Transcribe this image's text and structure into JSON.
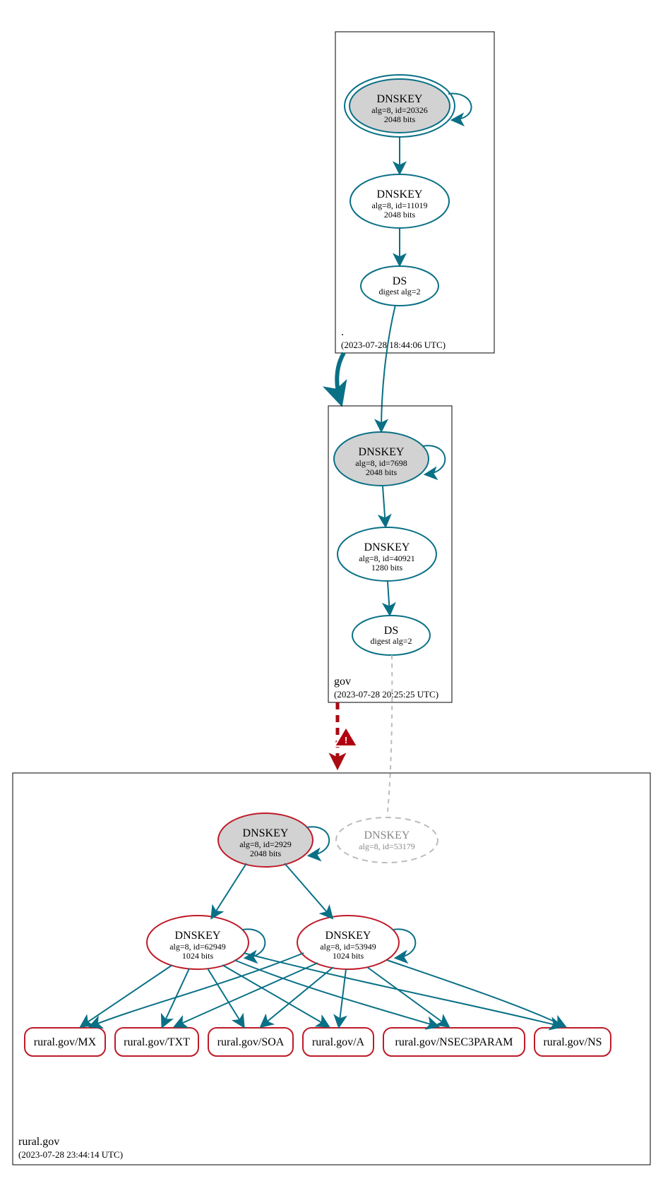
{
  "zones": {
    "root": {
      "label": ".",
      "timestamp": "(2023-07-28 18:44:06 UTC)"
    },
    "gov": {
      "label": "gov",
      "timestamp": "(2023-07-28 20:25:25 UTC)"
    },
    "rural": {
      "label": "rural.gov",
      "timestamp": "(2023-07-28 23:44:14 UTC)"
    }
  },
  "nodes": {
    "root_ksk": {
      "title": "DNSKEY",
      "line1": "alg=8, id=20326",
      "line2": "2048 bits"
    },
    "root_zsk": {
      "title": "DNSKEY",
      "line1": "alg=8, id=11019",
      "line2": "2048 bits"
    },
    "root_ds": {
      "title": "DS",
      "line1": "digest alg=2"
    },
    "gov_ksk": {
      "title": "DNSKEY",
      "line1": "alg=8, id=7698",
      "line2": "2048 bits"
    },
    "gov_zsk": {
      "title": "DNSKEY",
      "line1": "alg=8, id=40921",
      "line2": "1280 bits"
    },
    "gov_ds": {
      "title": "DS",
      "line1": "digest alg=2"
    },
    "rural_ksk": {
      "title": "DNSKEY",
      "line1": "alg=8, id=2929",
      "line2": "2048 bits"
    },
    "rural_miss": {
      "title": "DNSKEY",
      "line1": "alg=8, id=53179"
    },
    "rural_zsk1": {
      "title": "DNSKEY",
      "line1": "alg=8, id=62949",
      "line2": "1024 bits"
    },
    "rural_zsk2": {
      "title": "DNSKEY",
      "line1": "alg=8, id=53949",
      "line2": "1024 bits"
    }
  },
  "rrsets": {
    "mx": "rural.gov/MX",
    "txt": "rural.gov/TXT",
    "soa": "rural.gov/SOA",
    "a": "rural.gov/A",
    "nsec": "rural.gov/NSEC3PARAM",
    "ns": "rural.gov/NS"
  },
  "warning_icon": "!",
  "chart_data": {
    "type": "graph",
    "description": "DNSSEC delegation / signing graph (DNSViz-style) for rural.gov",
    "zones": [
      {
        "name": ".",
        "queried_at": "2023-07-28 18:44:06 UTC"
      },
      {
        "name": "gov",
        "queried_at": "2023-07-28 20:25:25 UTC"
      },
      {
        "name": "rural.gov",
        "queried_at": "2023-07-28 23:44:14 UTC"
      }
    ],
    "nodes": [
      {
        "id": "root_ksk",
        "zone": ".",
        "type": "DNSKEY",
        "alg": 8,
        "key_id": 20326,
        "bits": 2048,
        "role": "KSK/trust-anchor",
        "style": "double-ellipse-filled-teal"
      },
      {
        "id": "root_zsk",
        "zone": ".",
        "type": "DNSKEY",
        "alg": 8,
        "key_id": 11019,
        "bits": 2048,
        "role": "ZSK",
        "style": "ellipse-teal"
      },
      {
        "id": "root_ds",
        "zone": ".",
        "type": "DS",
        "digest_alg": 2,
        "style": "ellipse-teal"
      },
      {
        "id": "gov_ksk",
        "zone": "gov",
        "type": "DNSKEY",
        "alg": 8,
        "key_id": 7698,
        "bits": 2048,
        "role": "KSK",
        "style": "ellipse-filled-teal"
      },
      {
        "id": "gov_zsk",
        "zone": "gov",
        "type": "DNSKEY",
        "alg": 8,
        "key_id": 40921,
        "bits": 1280,
        "role": "ZSK",
        "style": "ellipse-teal"
      },
      {
        "id": "gov_ds",
        "zone": "gov",
        "type": "DS",
        "digest_alg": 2,
        "style": "ellipse-teal"
      },
      {
        "id": "rural_ksk",
        "zone": "rural.gov",
        "type": "DNSKEY",
        "alg": 8,
        "key_id": 2929,
        "bits": 2048,
        "role": "KSK",
        "style": "ellipse-filled-red"
      },
      {
        "id": "rural_miss",
        "zone": "rural.gov",
        "type": "DNSKEY",
        "alg": 8,
        "key_id": 53179,
        "role": "missing",
        "style": "ellipse-dashed-grey"
      },
      {
        "id": "rural_zsk1",
        "zone": "rural.gov",
        "type": "DNSKEY",
        "alg": 8,
        "key_id": 62949,
        "bits": 1024,
        "role": "ZSK",
        "style": "ellipse-red"
      },
      {
        "id": "rural_zsk2",
        "zone": "rural.gov",
        "type": "DNSKEY",
        "alg": 8,
        "key_id": 53949,
        "bits": 1024,
        "role": "ZSK",
        "style": "ellipse-red"
      },
      {
        "id": "rr_mx",
        "zone": "rural.gov",
        "type": "RRset",
        "name": "rural.gov/MX",
        "style": "rrect-red"
      },
      {
        "id": "rr_txt",
        "zone": "rural.gov",
        "type": "RRset",
        "name": "rural.gov/TXT",
        "style": "rrect-red"
      },
      {
        "id": "rr_soa",
        "zone": "rural.gov",
        "type": "RRset",
        "name": "rural.gov/SOA",
        "style": "rrect-red"
      },
      {
        "id": "rr_a",
        "zone": "rural.gov",
        "type": "RRset",
        "name": "rural.gov/A",
        "style": "rrect-red"
      },
      {
        "id": "rr_nsec",
        "zone": "rural.gov",
        "type": "RRset",
        "name": "rural.gov/NSEC3PARAM",
        "style": "rrect-red"
      },
      {
        "id": "rr_ns",
        "zone": "rural.gov",
        "type": "RRset",
        "name": "rural.gov/NS",
        "style": "rrect-red"
      }
    ],
    "edges": [
      {
        "from": "root_ksk",
        "to": "root_ksk",
        "kind": "self-sign",
        "style": "teal-solid"
      },
      {
        "from": "root_ksk",
        "to": "root_zsk",
        "kind": "signs",
        "style": "teal-solid"
      },
      {
        "from": "root_zsk",
        "to": "root_ds",
        "kind": "signs",
        "style": "teal-solid"
      },
      {
        "from": "root_ds",
        "to": "gov_ksk",
        "kind": "delegation",
        "style": "teal-solid"
      },
      {
        "from": ".",
        "to": "gov",
        "kind": "zone-deleg",
        "style": "teal-solid-thick"
      },
      {
        "from": "gov_ksk",
        "to": "gov_ksk",
        "kind": "self-sign",
        "style": "teal-solid"
      },
      {
        "from": "gov_ksk",
        "to": "gov_zsk",
        "kind": "signs",
        "style": "teal-solid"
      },
      {
        "from": "gov_zsk",
        "to": "gov_ds",
        "kind": "signs",
        "style": "teal-solid"
      },
      {
        "from": "gov_ds",
        "to": "rural_miss",
        "kind": "ds-to-key",
        "style": "grey-dashed"
      },
      {
        "from": "gov",
        "to": "rural.gov",
        "kind": "zone-deleg",
        "style": "red-dashed-thick",
        "status": "warning"
      },
      {
        "from": "rural_ksk",
        "to": "rural_ksk",
        "kind": "self-sign",
        "style": "teal-solid"
      },
      {
        "from": "rural_ksk",
        "to": "rural_zsk1",
        "kind": "signs",
        "style": "teal-solid"
      },
      {
        "from": "rural_ksk",
        "to": "rural_zsk2",
        "kind": "signs",
        "style": "teal-solid"
      },
      {
        "from": "rural_zsk1",
        "to": "rural_zsk1",
        "kind": "self-sign",
        "style": "teal-solid"
      },
      {
        "from": "rural_zsk2",
        "to": "rural_zsk2",
        "kind": "self-sign",
        "style": "teal-solid"
      },
      {
        "from": "rural_zsk1",
        "to": "rr_mx",
        "kind": "signs",
        "style": "teal-solid"
      },
      {
        "from": "rural_zsk1",
        "to": "rr_txt",
        "kind": "signs",
        "style": "teal-solid"
      },
      {
        "from": "rural_zsk1",
        "to": "rr_soa",
        "kind": "signs",
        "style": "teal-solid"
      },
      {
        "from": "rural_zsk1",
        "to": "rr_a",
        "kind": "signs",
        "style": "teal-solid"
      },
      {
        "from": "rural_zsk1",
        "to": "rr_nsec",
        "kind": "signs",
        "style": "teal-solid"
      },
      {
        "from": "rural_zsk1",
        "to": "rr_ns",
        "kind": "signs",
        "style": "teal-solid"
      },
      {
        "from": "rural_zsk2",
        "to": "rr_mx",
        "kind": "signs",
        "style": "teal-solid"
      },
      {
        "from": "rural_zsk2",
        "to": "rr_txt",
        "kind": "signs",
        "style": "teal-solid"
      },
      {
        "from": "rural_zsk2",
        "to": "rr_soa",
        "kind": "signs",
        "style": "teal-solid"
      },
      {
        "from": "rural_zsk2",
        "to": "rr_a",
        "kind": "signs",
        "style": "teal-solid"
      },
      {
        "from": "rural_zsk2",
        "to": "rr_nsec",
        "kind": "signs",
        "style": "teal-solid"
      },
      {
        "from": "rural_zsk2",
        "to": "rr_ns",
        "kind": "signs",
        "style": "teal-solid"
      }
    ]
  }
}
